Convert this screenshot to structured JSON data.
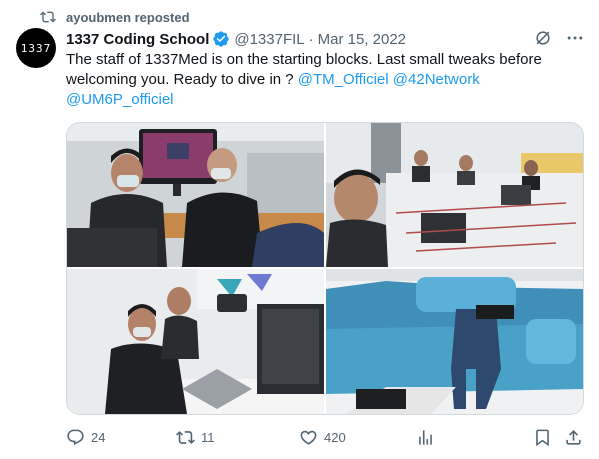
{
  "repost": {
    "text": "ayoubmen reposted",
    "icon": "repost-icon"
  },
  "author": {
    "avatar_text": "1337",
    "name": "1337 Coding School",
    "handle": "@1337FIL",
    "separator": "·",
    "date": "Mar 15, 2022",
    "verified": true
  },
  "tweet": {
    "text_plain": "The staff of 1337Med is on the starting blocks. Last small tweaks before welcoming you. Ready to dive in ? ",
    "mentions": [
      "@TM_Officiel",
      "@42Network",
      "@UM6P_officiel"
    ]
  },
  "media": {
    "photo_count": 4,
    "descriptions": [
      "staff at iMac workstation",
      "room with laptops and wiring",
      "staff working at laptops",
      "blue sofa lounge"
    ]
  },
  "actions": {
    "replies": "24",
    "reposts": "11",
    "likes": "420"
  },
  "colors": {
    "link": "#1d9bf0",
    "secondary": "#536471",
    "verified": "#1d9bf0",
    "border": "#cfd9de"
  }
}
